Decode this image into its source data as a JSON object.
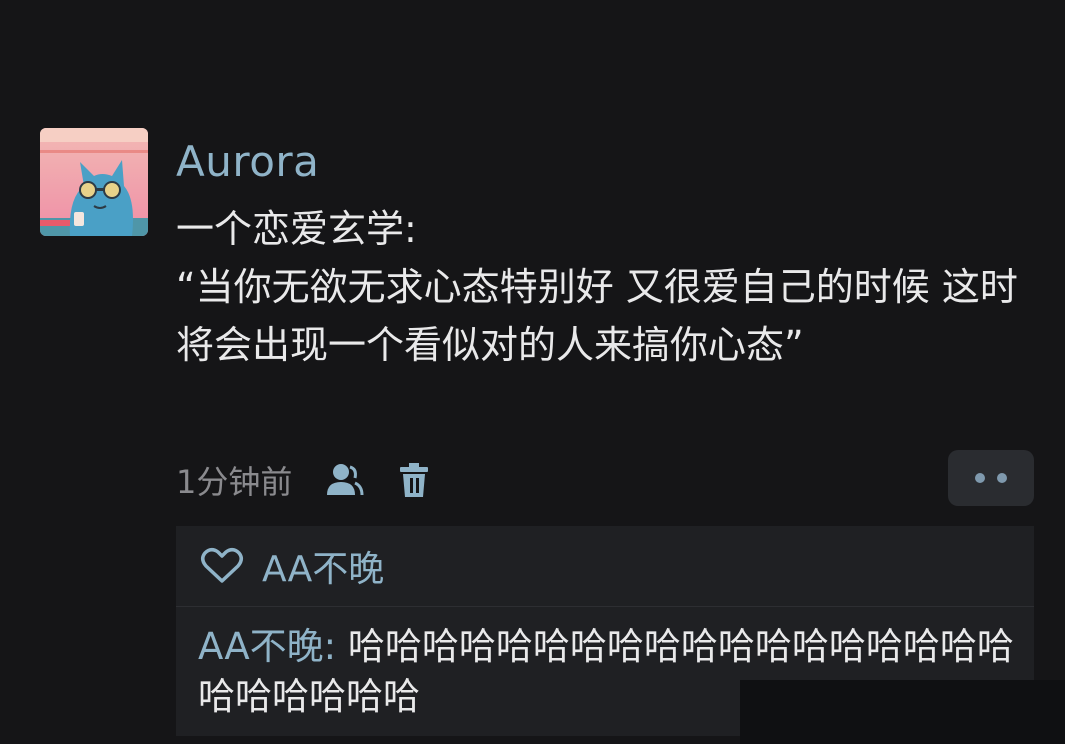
{
  "post": {
    "username": "Aurora",
    "text": "一个恋爱玄学:\n“当你无欲无求心态特别好 又很爱自己的时候 这时将会出现一个看似对的人来搞你心态”",
    "time": "1分钟前"
  },
  "likes": {
    "user": "AA不晚"
  },
  "comment": {
    "author": "AA不晚:",
    "text": " 哈哈哈哈哈哈哈哈哈哈哈哈哈哈哈哈哈哈哈哈哈哈哈哈"
  },
  "icons": {
    "like": "heart-icon",
    "user": "user-icon",
    "delete": "trash-icon",
    "more": "more-dots-icon"
  },
  "colors": {
    "background": "#151517",
    "username": "#8fb3c8",
    "text": "#e9e9ea",
    "muted": "#8a8a8e",
    "panel": "#1f2023"
  }
}
